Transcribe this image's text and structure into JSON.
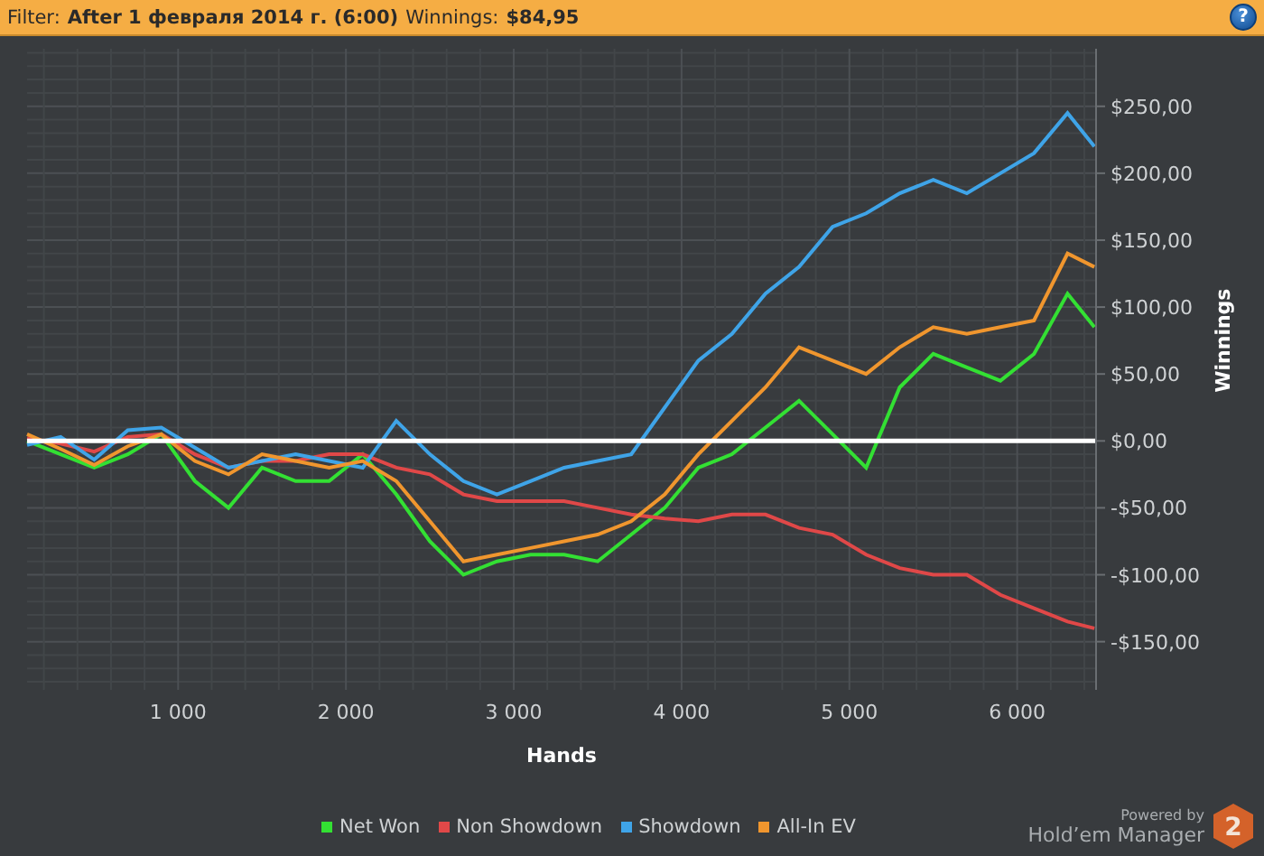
{
  "filter_bar": {
    "filter_label": "Filter:",
    "filter_value": "After 1 февраля 2014 г. (6:00)",
    "winnings_label": "Winnings:",
    "winnings_value": "$84,95",
    "help_button": "?"
  },
  "chart": {
    "chart_data": {
      "type": "line",
      "xlabel": "Hands",
      "ylabel": "Winnings",
      "x": [
        100,
        300,
        500,
        700,
        900,
        1100,
        1300,
        1500,
        1700,
        1900,
        2100,
        2300,
        2500,
        2700,
        2900,
        3100,
        3300,
        3500,
        3700,
        3900,
        4100,
        4300,
        4500,
        4700,
        4900,
        5100,
        5300,
        5500,
        5700,
        5900,
        6100,
        6300,
        6460
      ],
      "grid": true,
      "xlim": [
        100,
        6470
      ],
      "ylim": [
        -186,
        293
      ],
      "xticks": [
        {
          "value": 1000,
          "label": "1 000"
        },
        {
          "value": 2000,
          "label": "2 000"
        },
        {
          "value": 3000,
          "label": "3 000"
        },
        {
          "value": 4000,
          "label": "4 000"
        },
        {
          "value": 5000,
          "label": "5 000"
        },
        {
          "value": 6000,
          "label": "6 000"
        }
      ],
      "yticks": [
        {
          "value": 250,
          "label": "$250,00"
        },
        {
          "value": 200,
          "label": "$200,00"
        },
        {
          "value": 150,
          "label": "$150,00"
        },
        {
          "value": 100,
          "label": "$100,00"
        },
        {
          "value": 50,
          "label": "$50,00"
        },
        {
          "value": 0,
          "label": "$0,00"
        },
        {
          "value": -50,
          "label": "-$50,00"
        },
        {
          "value": -100,
          "label": "-$100,00"
        },
        {
          "value": -150,
          "label": "-$150,00"
        }
      ],
      "series": [
        {
          "name": "Net Won",
          "color": "#33e033",
          "values": [
            0,
            -10,
            -20,
            -10,
            5,
            -30,
            -50,
            -20,
            -30,
            -30,
            -10,
            -40,
            -75,
            -100,
            -90,
            -85,
            -85,
            -90,
            -70,
            -50,
            -20,
            -10,
            10,
            30,
            5,
            -20,
            40,
            65,
            55,
            45,
            65,
            110,
            85
          ]
        },
        {
          "name": "Non Showdown",
          "color": "#e04848",
          "values": [
            2,
            -2,
            -8,
            3,
            5,
            -10,
            -20,
            -15,
            -15,
            -10,
            -10,
            -20,
            -25,
            -40,
            -45,
            -45,
            -45,
            -50,
            -55,
            -58,
            -60,
            -55,
            -55,
            -65,
            -70,
            -85,
            -95,
            -100,
            -100,
            -115,
            -125,
            -135,
            -140
          ]
        },
        {
          "name": "Showdown",
          "color": "#3fa4e8",
          "values": [
            -3,
            3,
            -14,
            8,
            10,
            -5,
            -20,
            -15,
            -10,
            -15,
            -20,
            15,
            -10,
            -30,
            -40,
            -30,
            -20,
            -15,
            -10,
            25,
            60,
            80,
            110,
            130,
            160,
            170,
            185,
            195,
            185,
            200,
            215,
            245,
            220
          ]
        },
        {
          "name": "All-In EV",
          "color": "#f0962e",
          "values": [
            5,
            -6,
            -18,
            -4,
            5,
            -15,
            -25,
            -10,
            -15,
            -20,
            -15,
            -30,
            -60,
            -90,
            -85,
            -80,
            -75,
            -70,
            -60,
            -40,
            -10,
            15,
            40,
            70,
            60,
            50,
            70,
            85,
            80,
            85,
            90,
            140,
            130
          ]
        }
      ]
    }
  },
  "branding": {
    "powered_by": "Powered by",
    "product": "Hold’em Manager",
    "badge": "2"
  }
}
